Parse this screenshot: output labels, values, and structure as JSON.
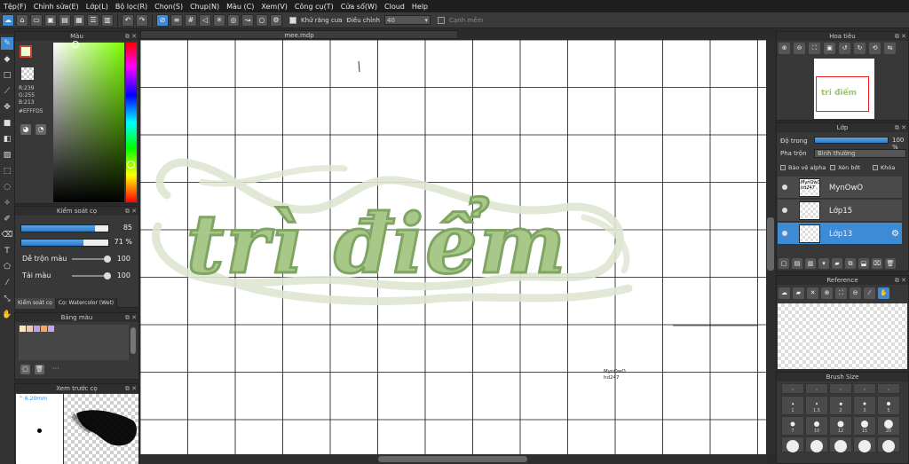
{
  "menu": [
    "Tệp(F)",
    "Chỉnh sửa(E)",
    "Lớp(L)",
    "Bộ lọc(R)",
    "Chọn(S)",
    "Chụp(N)",
    "Màu (C)",
    "Xem(V)",
    "Công cụ(T)",
    "Cửa sổ(W)",
    "Cloud",
    "Help"
  ],
  "toolbar": {
    "antialias_label": "Khử răng cưa",
    "correction_label": "Điều chỉnh",
    "correction_value": "40",
    "snap_label": "Cạnh mềm"
  },
  "color_panel": {
    "title": "Màu",
    "r": "R:239",
    "g": "G:255",
    "b": "B:213",
    "hex": "#EFFFD5",
    "current_color": "#efffd5"
  },
  "brush_control": {
    "title": "Kiểm soát cọ",
    "size": {
      "value": "85",
      "fraction": 0.85
    },
    "opacity": {
      "value": "71 %",
      "fraction": 0.71
    },
    "blend_label": "Dễ trộn màu",
    "blend_value": "100",
    "load_label": "Tải màu",
    "load_value": "100",
    "tab_control": "Kiểm soát cọ",
    "tab_brush": "Cọ: Watercolor (Wet)"
  },
  "swatch_panel": {
    "title": "Bảng màu",
    "colors": [
      "#f4e7c2",
      "#f2c8b0",
      "#b8a6d8",
      "#f3a45e",
      "#c6a6e6"
    ],
    "more": "···"
  },
  "preview_panel": {
    "title": "Xem trước cọ",
    "size_label": "⌃ 6.20mm"
  },
  "canvas": {
    "tab_title": "mee.mdp",
    "artwork_text": "trì điểm",
    "signature_line1": "MynOwO",
    "signature_line2": "hd247",
    "art_color": "#a8c88a",
    "outline_color": "#dfe6d2"
  },
  "navigator": {
    "title": "Hoa tiêu",
    "thumb_text": "tri điểm"
  },
  "layer_panel": {
    "title": "Lớp",
    "opacity_label": "Độ trong",
    "opacity_value": "100 %",
    "opacity_fraction": 1.0,
    "blend_label": "Pha trộn",
    "blend_value": "Bình thường",
    "protect_alpha": "Bảo vệ alpha",
    "clipping": "Xén bớt",
    "lock": "Khóa",
    "layers": [
      {
        "name": "MynOwO",
        "thumb": "MynOwO hd247",
        "selected": false
      },
      {
        "name": "Lớp15",
        "thumb": "",
        "selected": false
      },
      {
        "name": "Lớp13",
        "thumb": "",
        "selected": true
      }
    ]
  },
  "reference_panel": {
    "title": "Reference"
  },
  "brush_size_panel": {
    "title": "Brush Size",
    "sizes": [
      "1",
      "1.5",
      "2",
      "3",
      "5",
      "7",
      "10",
      "12",
      "15",
      "20"
    ]
  }
}
